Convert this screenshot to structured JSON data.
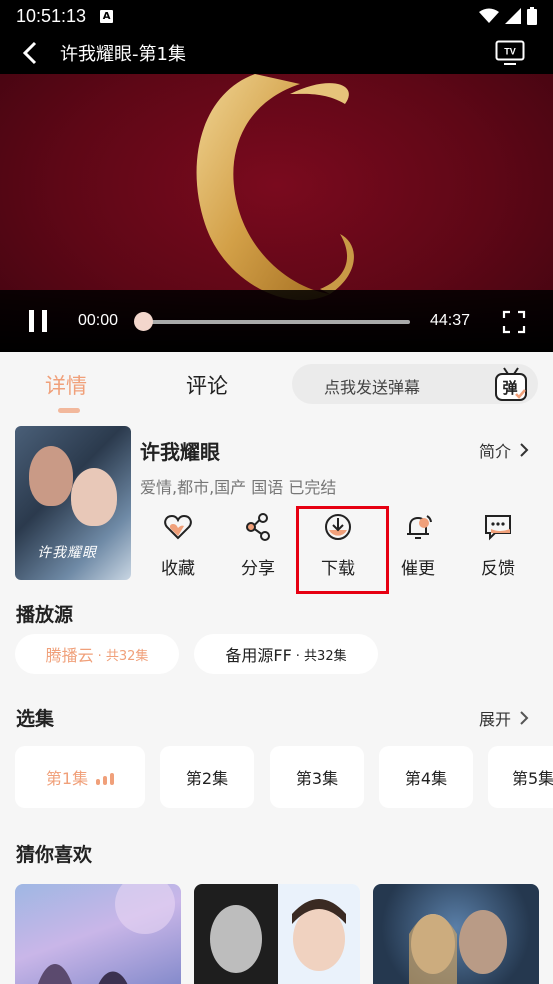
{
  "status_bar": {
    "time": "10:51:13",
    "notif_badge": "A"
  },
  "header": {
    "title": "许我耀眼-第1集"
  },
  "player": {
    "current_time": "00:00",
    "duration": "44:37",
    "progress": 0.0
  },
  "tabs": [
    {
      "label": "详情"
    },
    {
      "label": "评论"
    }
  ],
  "danmaku": {
    "placeholder": "点我发送弹幕",
    "icon_label": "弹"
  },
  "show": {
    "title": "许我耀眼",
    "intro_label": "简介",
    "tags": "爱情,都市,国产 国语 已完结",
    "poster_text": "许我耀眼"
  },
  "actions": [
    {
      "label": "收藏",
      "icon": "heart-icon"
    },
    {
      "label": "分享",
      "icon": "share-icon"
    },
    {
      "label": "下载",
      "icon": "download-icon"
    },
    {
      "label": "催更",
      "icon": "bell-icon"
    },
    {
      "label": "反馈",
      "icon": "feedback-icon"
    }
  ],
  "sources_section": {
    "title": "播放源",
    "items": [
      {
        "name": "腾播云",
        "count": "· 共32集"
      },
      {
        "name": "备用源FF",
        "count": "· 共32集"
      }
    ]
  },
  "episodes_section": {
    "title": "选集",
    "expand_label": "展开",
    "items": [
      "第1集",
      "第2集",
      "第3集",
      "第4集",
      "第5集"
    ]
  },
  "recommend_section": {
    "title": "猜你喜欢"
  },
  "colors": {
    "accent": "#f0a07a",
    "highlight": "#e60012"
  }
}
